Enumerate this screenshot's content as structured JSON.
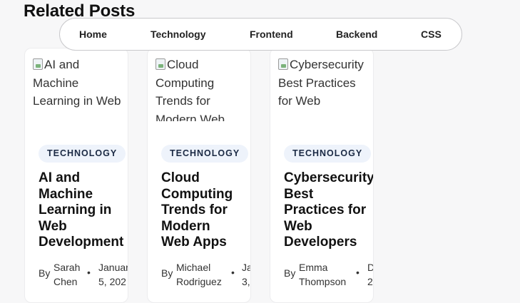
{
  "section": {
    "title": "Related Posts"
  },
  "nav": {
    "links": [
      {
        "label": "Home"
      },
      {
        "label": "Technology"
      },
      {
        "label": "Frontend"
      },
      {
        "label": "Backend"
      },
      {
        "label": "CSS"
      }
    ]
  },
  "posts": [
    {
      "image_alt": "AI and Machine Learning in Web",
      "category": "TECHNOLOGY",
      "title": "AI and Machine Learning in Web Development",
      "by": "By",
      "author": "Sarah Chen",
      "separator": "•",
      "date": "Januar\n5, 202"
    },
    {
      "image_alt": "Cloud Computing Trends for Modern Web",
      "category": "TECHNOLOGY",
      "title": "Cloud Computing Trends for Modern Web Apps",
      "by": "By",
      "author": "Michael Rodriguez",
      "separator": "•",
      "date": "Ja\n3,"
    },
    {
      "image_alt": "Cybersecurity Best Practices for Web",
      "category": "TECHNOLOGY",
      "title": "Cybersecurity Best Practices for Web Developers",
      "by": "By",
      "author": "Emma Thompson",
      "separator": "•",
      "date": "D\n2"
    }
  ]
}
